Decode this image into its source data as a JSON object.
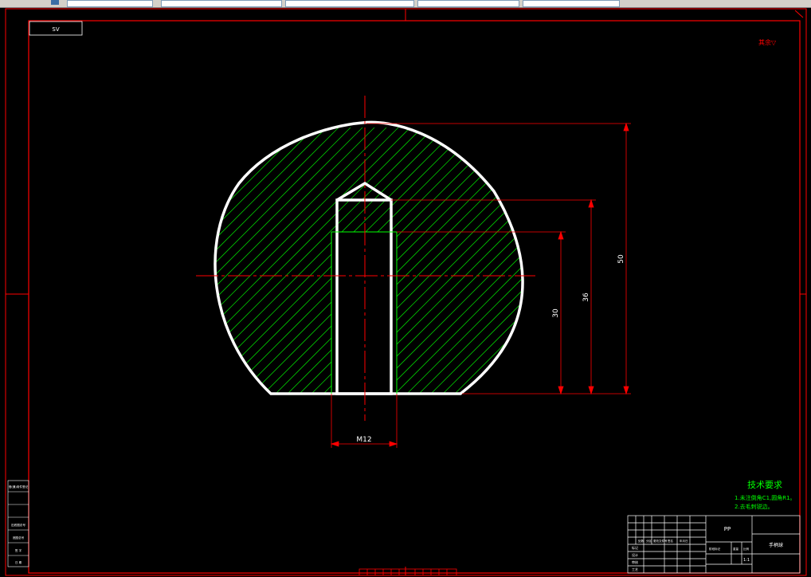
{
  "colors": {
    "frame": "#ff0000",
    "outline": "#ffffff",
    "hatch": "#00c800",
    "centerline": "#ff0000",
    "dimension": "#ff0000",
    "text_green": "#00ff00",
    "background": "#000000"
  },
  "drawing": {
    "corner_label": "ЅV",
    "roughness_note": "其余▽",
    "dimensions": {
      "overall_height": "50",
      "hole_depth": "36",
      "thread_depth": "30",
      "thread_size": "M12"
    }
  },
  "tech_requirements": {
    "title": "技术要求",
    "items": [
      "1.未注倒角C1,圆角R1。",
      "2.去毛刺锐边。"
    ]
  },
  "title_block": {
    "material": "PP",
    "part_name": "手柄球",
    "scale": "1:1",
    "row_labels": [
      "标记",
      "设计",
      "审核",
      "工艺"
    ],
    "header_labels": [
      "处数",
      "分区",
      "更改文件号",
      "签名",
      "年月日"
    ],
    "stage_labels": [
      "阶段标记",
      "重量",
      "比例"
    ]
  },
  "left_strip": [
    "借(通)用件登记",
    "旧底图总号",
    "底图总号",
    "签 字",
    "日 期"
  ],
  "toolbar": {
    "fields": [
      "",
      "",
      "",
      "",
      ""
    ]
  }
}
